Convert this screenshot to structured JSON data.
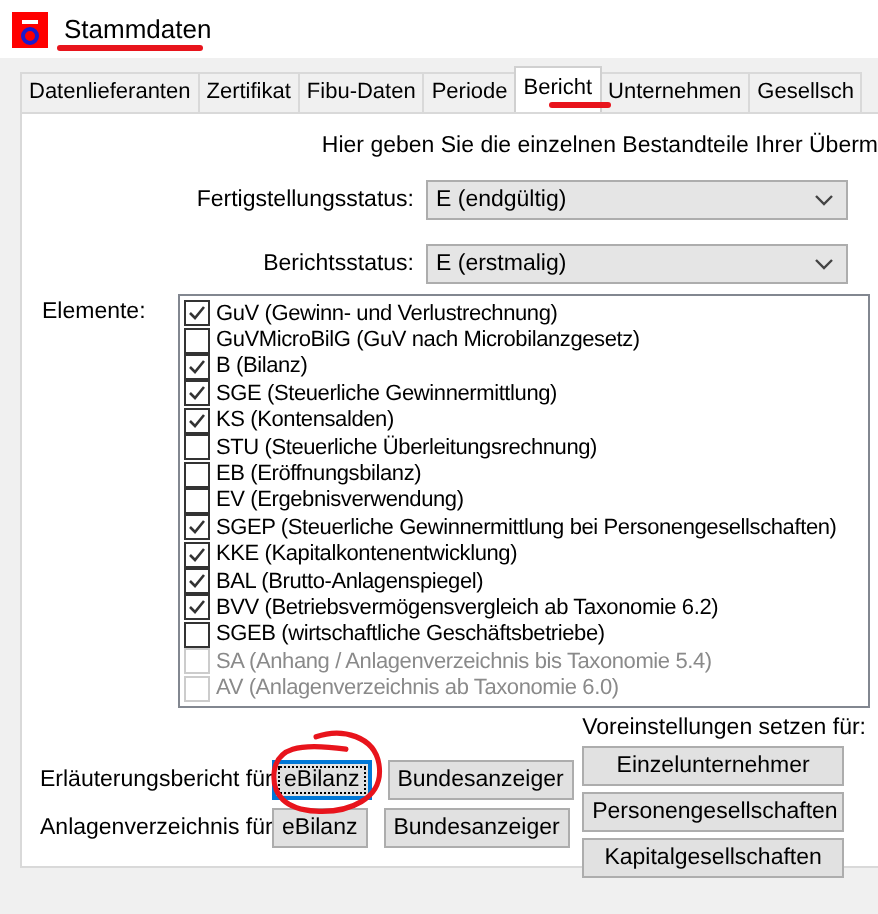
{
  "window": {
    "title": "Stammdaten"
  },
  "tabs": [
    {
      "label": "Datenlieferanten",
      "selected": false
    },
    {
      "label": "Zertifikat",
      "selected": false
    },
    {
      "label": "Fibu-Daten",
      "selected": false
    },
    {
      "label": "Periode",
      "selected": false
    },
    {
      "label": "Bericht",
      "selected": true
    },
    {
      "label": "Unternehmen",
      "selected": false
    },
    {
      "label": "Gesellsch",
      "selected": false
    }
  ],
  "intro": "Hier geben Sie die einzelnen Bestandteile Ihrer Überm",
  "dropdowns": [
    {
      "label": "Fertigstellungsstatus:",
      "value": "E (endgültig)"
    },
    {
      "label": "Berichtsstatus:",
      "value": "E (erstmalig)"
    }
  ],
  "elements_label": "Elemente:",
  "elements": [
    {
      "label": "GuV (Gewinn- und Verlustrechnung)",
      "checked": true,
      "disabled": false
    },
    {
      "label": "GuVMicroBilG (GuV nach Microbilanzgesetz)",
      "checked": false,
      "disabled": false
    },
    {
      "label": "B (Bilanz)",
      "checked": true,
      "disabled": false
    },
    {
      "label": "SGE (Steuerliche Gewinnermittlung)",
      "checked": true,
      "disabled": false
    },
    {
      "label": "KS (Kontensalden)",
      "checked": true,
      "disabled": false
    },
    {
      "label": "STU (Steuerliche Überleitungsrechnung)",
      "checked": false,
      "disabled": false
    },
    {
      "label": "EB (Eröffnungsbilanz)",
      "checked": false,
      "disabled": false
    },
    {
      "label": "EV (Ergebnisverwendung)",
      "checked": false,
      "disabled": false
    },
    {
      "label": "SGEP (Steuerliche Gewinnermittlung bei Personengesellschaften)",
      "checked": true,
      "disabled": false
    },
    {
      "label": "KKE (Kapitalkontenentwicklung)",
      "checked": true,
      "disabled": false
    },
    {
      "label": "BAL (Brutto-Anlagenspiegel)",
      "checked": true,
      "disabled": false
    },
    {
      "label": "BVV (Betriebsvermögensvergleich ab Taxonomie 6.2)",
      "checked": true,
      "disabled": false
    },
    {
      "label": "SGEB (wirtschaftliche Geschäftsbetriebe)",
      "checked": false,
      "disabled": false
    },
    {
      "label": "SA (Anhang / Anlagenverzeichnis bis Taxonomie 5.4)",
      "checked": false,
      "disabled": true
    },
    {
      "label": "AV (Anlagenverzeichnis ab Taxonomie 6.0)",
      "checked": false,
      "disabled": true
    }
  ],
  "report_rows": [
    {
      "label": "Erläuterungsbericht für",
      "buttons": [
        {
          "label": "eBilanz",
          "focused": true
        },
        {
          "label": "Bundesanzeiger",
          "focused": false
        }
      ]
    },
    {
      "label": "Anlagenverzeichnis für",
      "buttons": [
        {
          "label": "eBilanz",
          "focused": false
        },
        {
          "label": "Bundesanzeiger",
          "focused": false
        }
      ]
    }
  ],
  "presets": {
    "title": "Voreinstellungen setzen für:",
    "buttons": [
      "Einzelunternehmer",
      "Personengesellschaften",
      "Kapitalgesellschaften"
    ]
  }
}
